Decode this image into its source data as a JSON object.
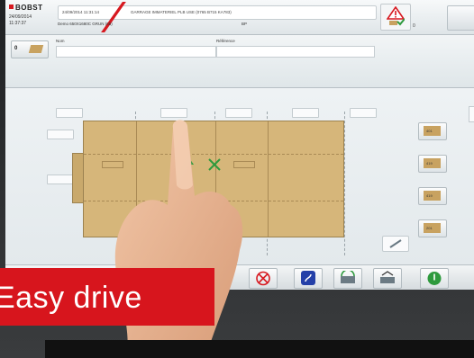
{
  "header": {
    "brand": "BOBST",
    "date": "24/09/2014",
    "time": "11:37:37",
    "job_timestamp": "24/09/2014 11:31:14",
    "job_title": "GARRAGE IMMATERIEL PLB USE (0765 B715 KA783)",
    "machine_label": "Demo 650X1680C GRUN (65)",
    "op_code": "BP",
    "badge_count": "0"
  },
  "form": {
    "counter_value": "0",
    "name_label": "Nom",
    "reference_label": "Référence",
    "name_value": "",
    "reference_value": ""
  },
  "side_buttons": [
    {
      "label": "401"
    },
    {
      "label": "419"
    },
    {
      "label": "419"
    },
    {
      "label": "201"
    }
  ],
  "toolbar": {
    "buttons": [
      "no-entry-icon",
      "music-icon",
      "machine-sync-icon",
      "machine-adjust-icon",
      "power-icon"
    ]
  },
  "banner": {
    "text": "Easy drive"
  },
  "colors": {
    "brand_red": "#d71920",
    "board": "#d6b67a",
    "banner_red": "#d7151d",
    "ok_green": "#2e9a3d",
    "action_blue": "#2440a8"
  }
}
